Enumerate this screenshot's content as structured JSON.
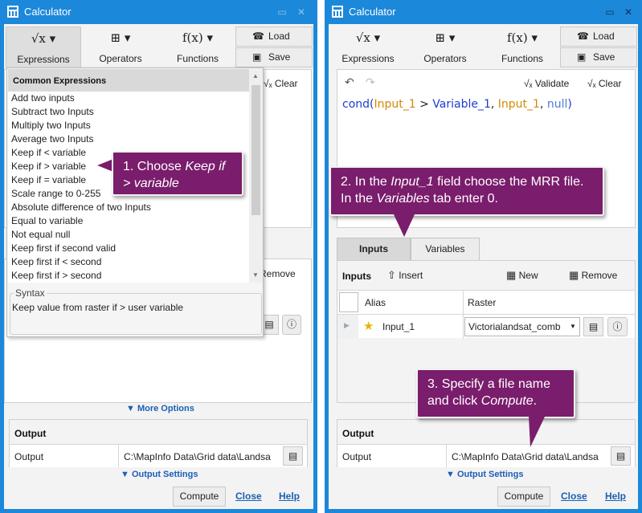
{
  "left": {
    "title": "Calculator",
    "toolbar": {
      "expressions": "Expressions",
      "operators": "Operators",
      "functions": "Functions",
      "load": "Load",
      "save": "Save"
    },
    "clear": "Clear",
    "remove": "Remove",
    "dropdown": {
      "header": "Common Expressions",
      "items": [
        "Add two inputs",
        "Subtract two Inputs",
        "Multiply two Inputs",
        "Average two Inputs",
        "Keep if < variable",
        "Keep if > variable",
        "Keep if = variable",
        "Scale range to 0-255",
        "Absolute difference of two Inputs",
        "Equal to variable",
        "Not equal null",
        "Keep first if second valid",
        "Keep first if < second",
        "Keep first if > second"
      ],
      "syntax_label": "Syntax",
      "syntax_text": "Keep value from raster if > user variable"
    },
    "more_options": "More Options",
    "output": {
      "header": "Output",
      "label": "Output",
      "path": "C:\\MapInfo Data\\Grid data\\Landsa"
    },
    "output_settings": "Output Settings",
    "compute": "Compute",
    "close": "Close",
    "help": "Help",
    "callout": {
      "prefix": "1. Choose ",
      "italic": "Keep if > variable"
    }
  },
  "right": {
    "title": "Calculator",
    "toolbar": {
      "expressions": "Expressions",
      "operators": "Operators",
      "functions": "Functions",
      "load": "Load",
      "save": "Save"
    },
    "validate": "Validate",
    "clear": "Clear",
    "expression": {
      "p1": "cond(",
      "p2": "Input_1",
      "p3": " > ",
      "p4": "Variable_1",
      "p5": ", ",
      "p6": "Input_1",
      "p7": ", ",
      "p8": "null",
      "p9": ")"
    },
    "tabs": [
      "Inputs",
      "Variables"
    ],
    "inputs_header": "Inputs",
    "insert": "Insert",
    "new": "New",
    "remove": "Remove",
    "columns": [
      "Alias",
      "Raster"
    ],
    "row": {
      "alias": "Input_1",
      "raster": "Victorialandsat_comb"
    },
    "output": {
      "header": "Output",
      "label": "Output",
      "path": "C:\\MapInfo Data\\Grid data\\Landsa"
    },
    "output_settings": "Output Settings",
    "compute": "Compute",
    "close": "Close",
    "help": "Help",
    "callout2": {
      "a": "2. In the ",
      "b": "Input_1",
      "c": "  field choose the MRR file. In the ",
      "d": "Variables",
      "e": " tab enter 0."
    },
    "callout3": {
      "a": "3. Specify a file name and click ",
      "b": "Compute",
      "c": "."
    }
  }
}
